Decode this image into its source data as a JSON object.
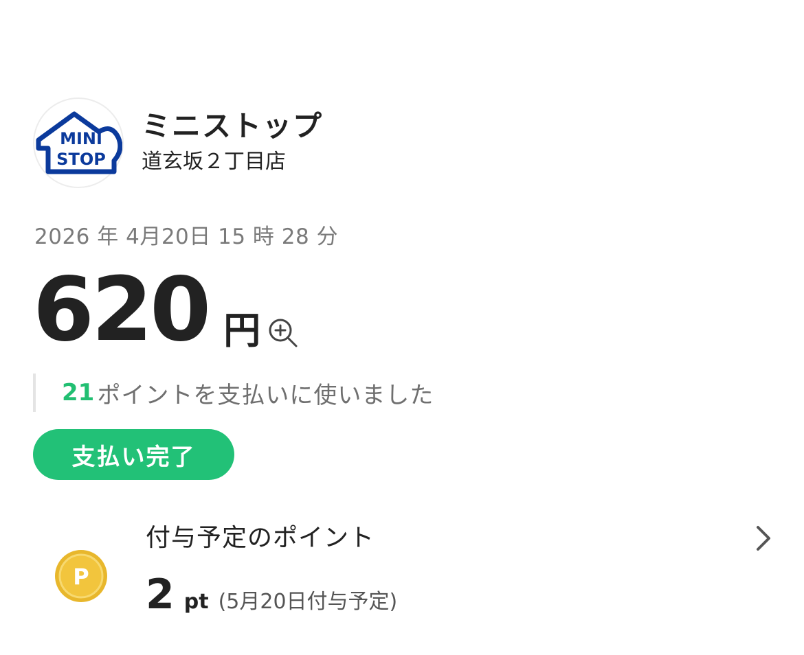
{
  "store": {
    "logo_text_line1": "MINI",
    "logo_text_line2": "STOP",
    "name": "ミニストップ",
    "branch": "道玄坂２丁目店"
  },
  "transaction": {
    "datetime": "2026 年 4月20日 15 時 28 分",
    "amount": "620",
    "currency": "円",
    "points_used": "21",
    "points_used_text": "ポイントを支払いに使いました",
    "status": "支払い完了"
  },
  "reward": {
    "label": "付与予定のポイント",
    "value": "2",
    "unit": "pt",
    "note": "(5月20日付与予定)",
    "coin_letter": "P"
  },
  "colors": {
    "accent_green": "#22c177",
    "logo_blue": "#0b3a9c",
    "coin_gold": "#f2c53d"
  },
  "icons": {
    "zoom": "zoom-in-icon",
    "chevron": "chevron-right-icon",
    "coin": "point-coin-icon"
  }
}
